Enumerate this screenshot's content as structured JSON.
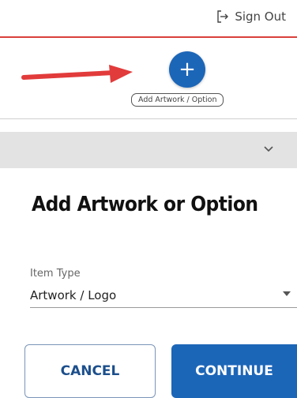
{
  "header": {
    "sign_out_label": "Sign Out",
    "sign_out_icon": "sign-out-icon"
  },
  "add_area": {
    "add_button_icon": "plus-icon",
    "add_button_symbol": "+",
    "tooltip": "Add Artwork / Option",
    "arrow_color": "#e23b3b"
  },
  "collapse_bar": {
    "icon": "chevron-down-icon"
  },
  "form": {
    "title": "Add Artwork or Option",
    "item_type": {
      "label": "Item Type",
      "value": "Artwork / Logo"
    }
  },
  "actions": {
    "cancel_label": "CANCEL",
    "continue_label": "CONTINUE"
  },
  "colors": {
    "primary": "#1c66b8",
    "header_rule": "#d9403a",
    "gray_bar": "#e3e3e3"
  }
}
